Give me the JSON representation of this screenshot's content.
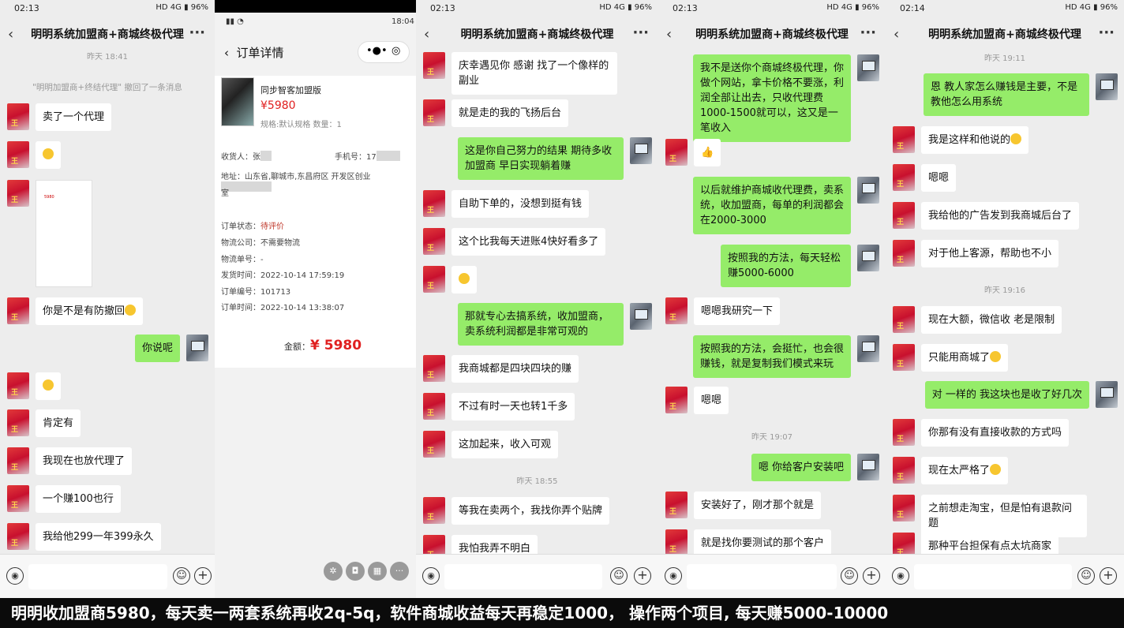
{
  "chat_title": "明明系统加盟商+商城终极代理",
  "caption": "明明收加盟商5980，每天卖一两套系统再收2q-5q，软件商城收益每天再稳定1000， 操作两个项目, 每天赚5000-10000",
  "status": {
    "p1_time": "02:13",
    "p3_time": "02:13",
    "p4_time": "02:13",
    "p5_time": "02:14",
    "p2_time": "18:04",
    "battery": "96%",
    "net": "HD 4G"
  },
  "panel1": {
    "timestamp": "昨天 18:41",
    "recall_notice": "\"明明加盟商+终结代理\" 撤回了一条消息",
    "image_price": "5980",
    "msgs": [
      "卖了一个代理",
      "你是不是有防撤回",
      "你说呢",
      "肯定有",
      "我现在也放代理了",
      "一个赚100也行",
      "我给他299一年399永久"
    ]
  },
  "order": {
    "title": "订单详情",
    "product_name": "同步智客加盟版",
    "price": "¥5980",
    "spec": "规格:默认规格 数量：1",
    "receiver_label": "收货人：张",
    "phone_label": "手机号：17",
    "address": "地址：山东省,聊城市,东昌府区 开发区创业",
    "address2": "室",
    "status_label": "订单状态：",
    "status_value": "待评价",
    "logistics": "物流公司：不需要物流",
    "tracking": "物流单号：-",
    "ship_time": "发货时间：2022-10-14 17:59:19",
    "order_no": "订单编号：101713",
    "order_time": "订单时间：2022-10-14 13:38:07",
    "total_label": "金额：",
    "total_value": "¥ 5980"
  },
  "panel3": {
    "timestamp": "昨天 18:55",
    "msgs": [
      "庆幸遇见你 感谢 找了一个像样的副业",
      "就是走的我的飞扬后台",
      "这是你自己努力的结果 期待多收加盟商 早日实现躺着赚",
      "自助下单的，没想到挺有钱",
      "这个比我每天进账4快好看多了",
      "那就专心去搞系统，收加盟商，卖系统利润都是非常可观的",
      "我商城都是四块四块的赚",
      "不过有时一天也转1千多",
      "这加起来，收入可观",
      "等我在卖两个，我找你弄个贴牌",
      "我怕我弄不明白"
    ]
  },
  "panel4": {
    "timestamp": "昨天 19:07",
    "msgs": [
      "我不是送你个商城终极代理，你做个网站，拿卡价格不要涨，利润全部让出去，只收代理费1000-1500就可以，这又是一笔收入",
      "以后就维护商城收代理费，卖系统，收加盟商，每单的利润都会在2000-3000",
      "按照我的方法，每天轻松赚5000-6000",
      "嗯嗯我研究一下",
      "按照我的方法，会挺忙，也会很赚钱，就是复制我们模式来玩",
      "嗯嗯",
      "嗯 你给客户安装吧",
      "安装好了，刚才那个就是",
      "就是找你要测试的那个客户"
    ]
  },
  "panel5": {
    "timestamp1": "昨天 19:11",
    "timestamp2": "昨天 19:16",
    "msgs": [
      "恩 教人家怎么赚钱是主要，不是教他怎么用系统",
      "我是这样和他说的",
      "嗯嗯",
      "我给他的广告发到我商城后台了",
      "对于他上客源，帮助也不小",
      "现在大额，微信收 老是限制",
      "只能用商城了",
      "对 一样的 我这块也是收了好几次",
      "你那有没有直接收款的方式吗",
      "现在太严格了",
      "之前想走淘宝，但是怕有退款问题",
      "那种平台担保有点太坑商家"
    ]
  }
}
